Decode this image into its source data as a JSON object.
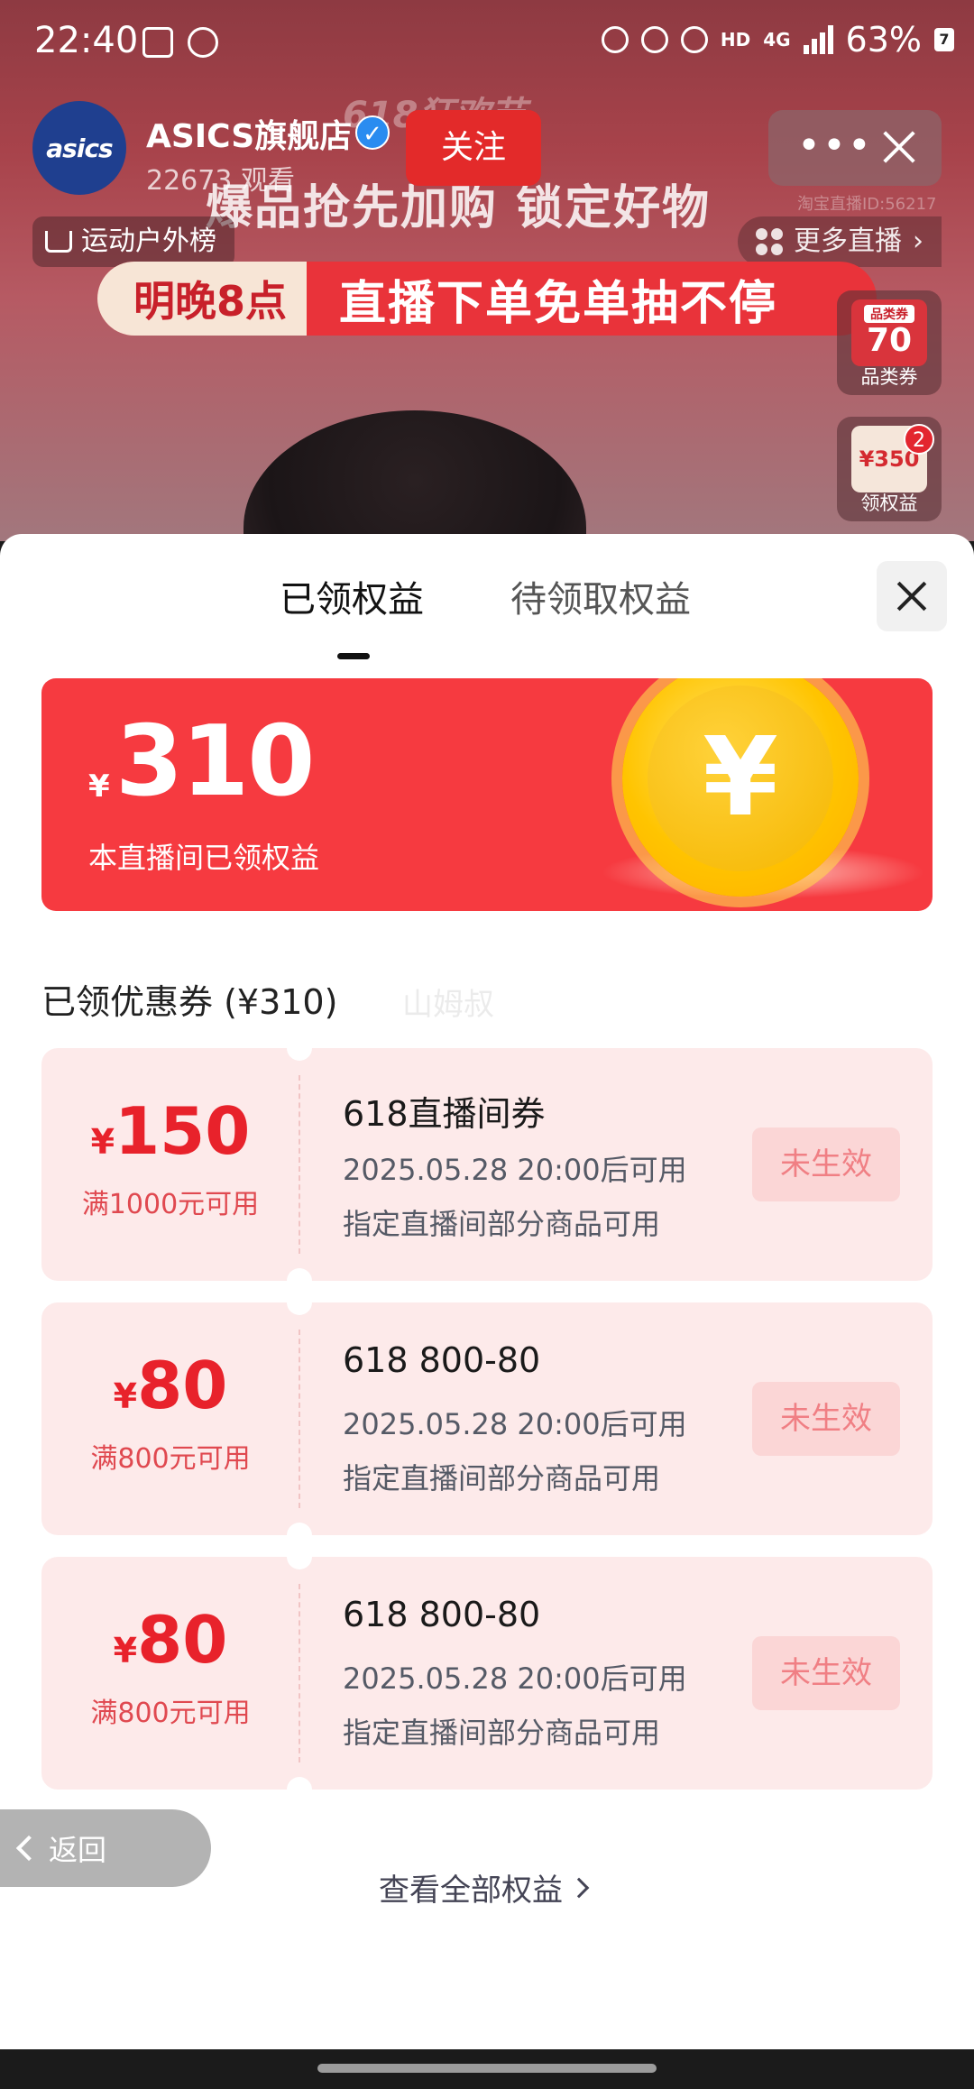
{
  "status_bar": {
    "time": "22:40",
    "battery": "63%",
    "hd_label": "HD",
    "network": "4G"
  },
  "stream": {
    "store_name": "ASICS旗舰店",
    "logo_text": "asics",
    "viewer_count": "22673 观看",
    "follow_label": "关注",
    "stream_id": "淘宝直播ID:56217",
    "brand_banner": "618狂欢节",
    "headline": "爆品抢先加购  锁定好物",
    "rank_label": "运动户外榜",
    "more_live_label": "更多直播",
    "sale_banner_left": "明晚8点",
    "sale_banner_right": "直播下单免单抽不停",
    "side_cards": [
      {
        "thumb": "70",
        "tag": "品类券",
        "label": "品类券"
      },
      {
        "thumb": "¥350",
        "badge": "2",
        "label": "领权益"
      }
    ]
  },
  "sheet": {
    "tabs": [
      {
        "label": "已领权益",
        "active": true
      },
      {
        "label": "待领取权益",
        "active": false
      }
    ],
    "summary": {
      "currency": "¥",
      "amount": "310",
      "caption": "本直播间已领权益",
      "coin_symbol": "¥"
    },
    "section_title": "已领优惠券 (¥310)",
    "watermark": "山姆叔",
    "coupons": [
      {
        "currency": "¥",
        "amount": "150",
        "condition": "满1000元可用",
        "title": "618直播间券",
        "validity": "2025.05.28 20:00后可用",
        "scope": "指定直播间部分商品可用",
        "status": "未生效"
      },
      {
        "currency": "¥",
        "amount": "80",
        "condition": "满800元可用",
        "title": "618 800-80",
        "validity": "2025.05.28 20:00后可用",
        "scope": "指定直播间部分商品可用",
        "status": "未生效"
      },
      {
        "currency": "¥",
        "amount": "80",
        "condition": "满800元可用",
        "title": "618 800-80",
        "validity": "2025.05.28 20:00后可用",
        "scope": "指定直播间部分商品可用",
        "status": "未生效"
      }
    ],
    "back_label": "返回",
    "view_all_label": "查看全部权益"
  },
  "colors": {
    "accent_red": "#f63a40",
    "coupon_bg": "#fdeaea",
    "coin_gold": "#ffc400"
  }
}
